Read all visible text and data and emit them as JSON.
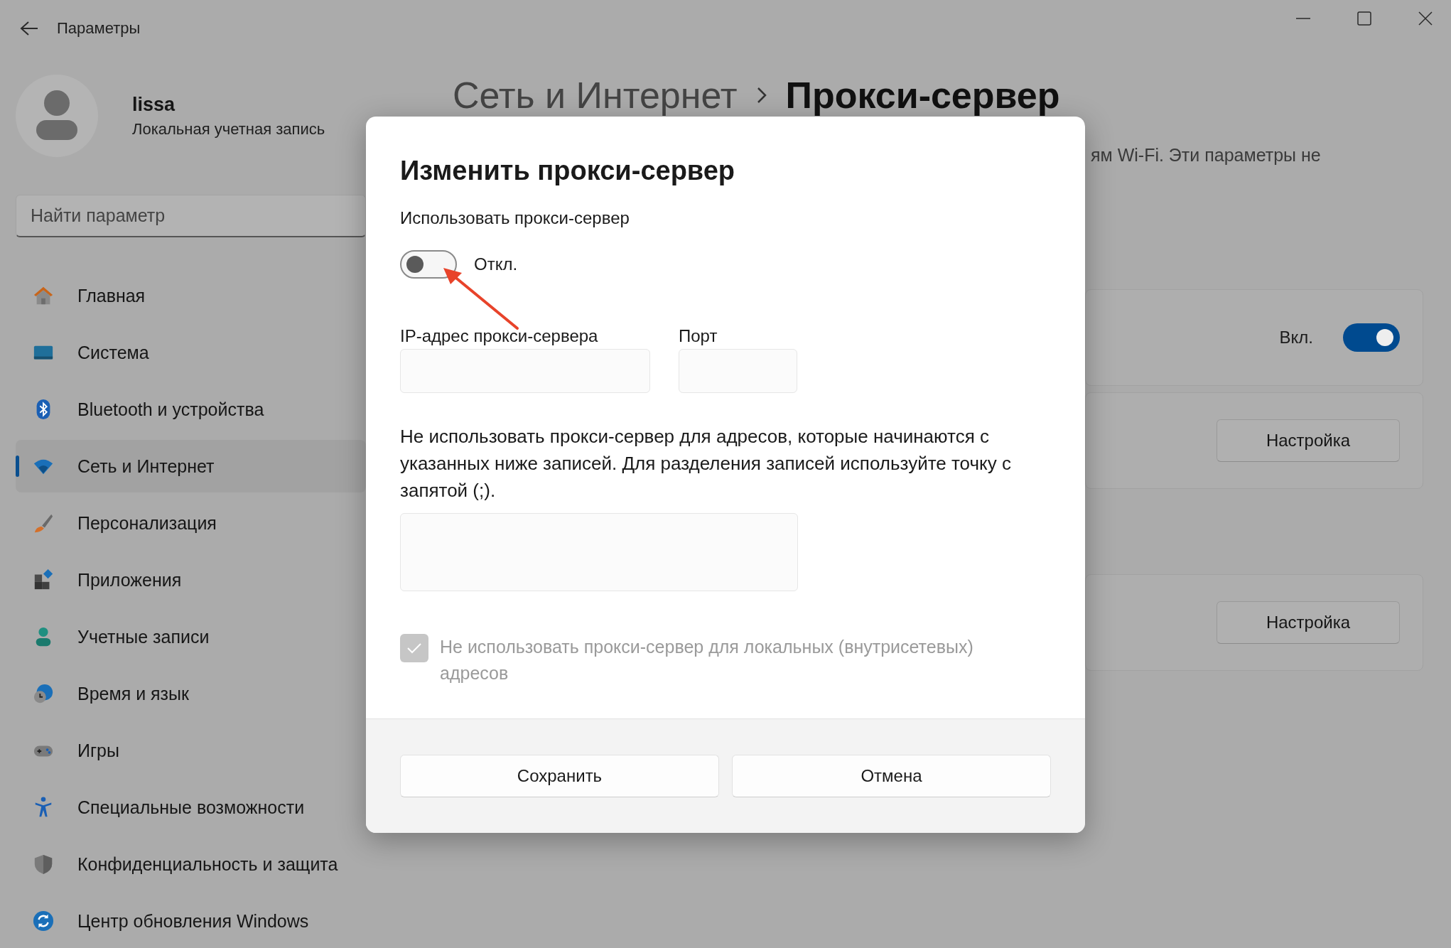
{
  "window": {
    "title": "Параметры"
  },
  "profile": {
    "name": "lissa",
    "account_type": "Локальная учетная запись"
  },
  "search": {
    "placeholder": "Найти параметр"
  },
  "sidebar": {
    "items": [
      {
        "label": "Главная",
        "selected": false
      },
      {
        "label": "Система",
        "selected": false
      },
      {
        "label": "Bluetooth и устройства",
        "selected": false
      },
      {
        "label": "Сеть и Интернет",
        "selected": true
      },
      {
        "label": "Персонализация",
        "selected": false
      },
      {
        "label": "Приложения",
        "selected": false
      },
      {
        "label": "Учетные записи",
        "selected": false
      },
      {
        "label": "Время и язык",
        "selected": false
      },
      {
        "label": "Игры",
        "selected": false
      },
      {
        "label": "Специальные возможности",
        "selected": false
      },
      {
        "label": "Конфиденциальность и защита",
        "selected": false
      },
      {
        "label": "Центр обновления Windows",
        "selected": false
      }
    ]
  },
  "breadcrumb": {
    "parent": "Сеть и Интернет",
    "current": "Прокси-сервер"
  },
  "background": {
    "description_fragment": "ям Wi-Fi. Эти параметры не",
    "cards": [
      {
        "kind": "toggle",
        "state_label": "Вкл.",
        "on": true
      },
      {
        "kind": "button",
        "button": "Настройка"
      },
      {
        "kind": "button",
        "button": "Настройка"
      }
    ]
  },
  "dialog": {
    "title": "Изменить прокси-сервер",
    "toggle_label": "Использовать прокси-сервер",
    "toggle": {
      "on": false,
      "state_label": "Откл."
    },
    "ip_label": "IP-адрес прокси-сервера",
    "port_label": "Порт",
    "exceptions_text": "Не использовать прокси-сервер для адресов, которые начинаются с указанных ниже записей. Для разделения записей используйте точку с запятой (;).",
    "local_checkbox": {
      "label": "Не использовать прокси-сервер для локальных (внутрисетевых) адресов",
      "checked": true,
      "disabled": true
    },
    "buttons": [
      "Сохранить",
      "Отмена"
    ]
  }
}
